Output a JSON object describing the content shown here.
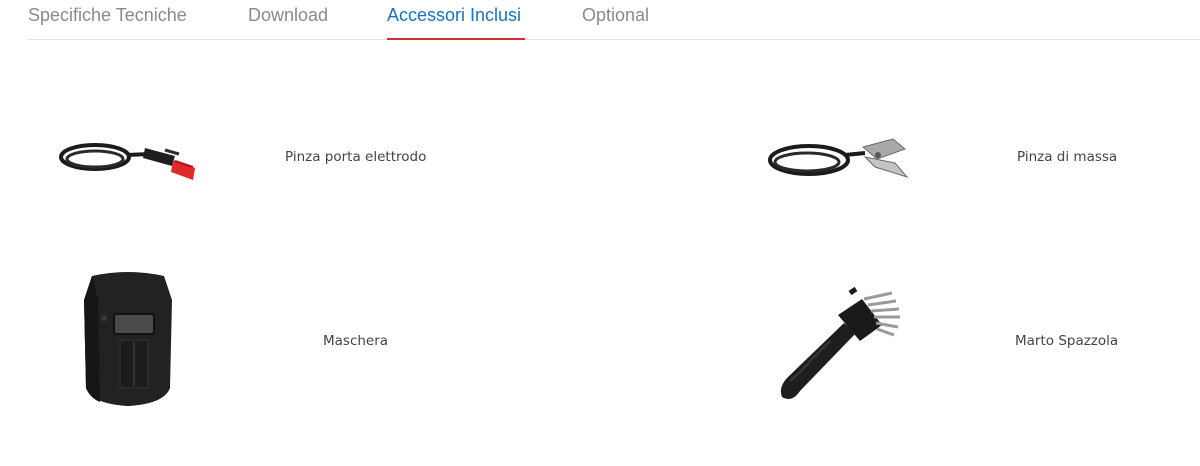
{
  "tabs": [
    {
      "label": "Specifiche Tecniche",
      "active": false
    },
    {
      "label": "Download",
      "active": false
    },
    {
      "label": "Accessori Inclusi",
      "active": true
    },
    {
      "label": "Optional",
      "active": false
    }
  ],
  "accessories": [
    {
      "label": "Pinza porta elettrodo",
      "icon": "electrode-holder-icon"
    },
    {
      "label": "Pinza di massa",
      "icon": "ground-clamp-icon"
    },
    {
      "label": "Maschera",
      "icon": "welding-mask-icon"
    },
    {
      "label": "Marto Spazzola",
      "icon": "hammer-brush-icon"
    }
  ],
  "colors": {
    "tab_text": "#8a8a8a",
    "tab_active_text": "#1a73b8",
    "tab_active_underline": "#d2312b",
    "divider": "#e2e2e2",
    "label_text": "#444444"
  }
}
